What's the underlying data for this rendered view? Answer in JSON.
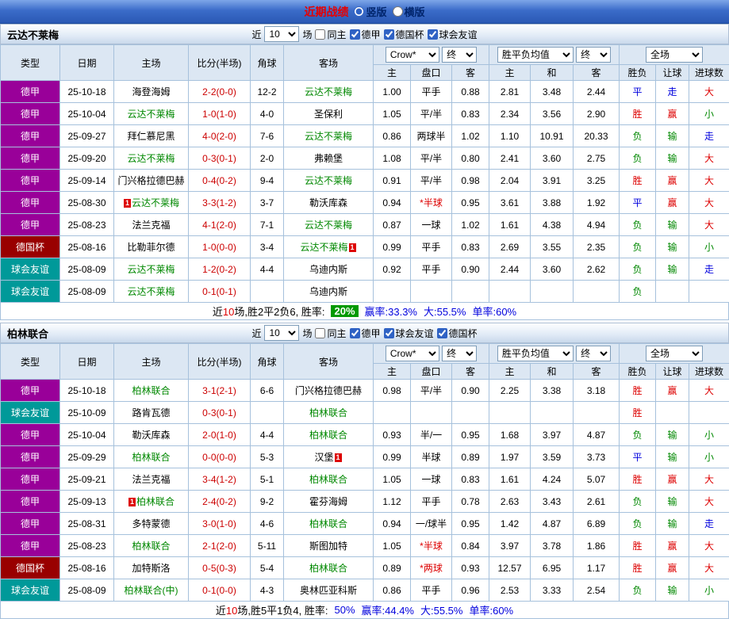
{
  "topbar": {
    "title": "近期战绩",
    "view_options": [
      {
        "label": "竖版",
        "selected": true
      },
      {
        "label": "横版",
        "selected": false
      }
    ]
  },
  "controls": {
    "recent_label": "近",
    "recent_value": "10",
    "games_label": "场",
    "same_home_label": "同主",
    "odds_company_select": "Crow*",
    "final_select": "终",
    "wdl_select": "胜平负均值",
    "scope_select": "全场"
  },
  "columns": {
    "type": "类型",
    "date": "日期",
    "home": "主场",
    "score": "比分(半场)",
    "corner": "角球",
    "away": "客场",
    "ah_home": "主",
    "ah_line": "盘口",
    "ah_away": "客",
    "eu_home": "主",
    "eu_draw": "和",
    "eu_away": "客",
    "wdl": "胜负",
    "handicap": "让球",
    "goals": "进球数"
  },
  "colors": {
    "league_dejia": "#990099",
    "league_deguobei": "#990000",
    "league_qiuhuiyouyi": "#009999",
    "result_win": "#dd0000",
    "result_draw": "#0000dd",
    "result_lose": "#008800",
    "focus_team": "#008800",
    "score_text": "#cc0000",
    "rate_badge_bg": "#009900"
  },
  "sections": [
    {
      "team": "云达不莱梅",
      "filter_leagues": [
        "德甲",
        "德国杯",
        "球会友谊"
      ],
      "rows": [
        {
          "type": "德甲",
          "date": "25-10-18",
          "home": {
            "t": "海登海姆"
          },
          "score": "2-2(0-0)",
          "corner": "12-2",
          "away": {
            "t": "云达不莱梅",
            "focus": true
          },
          "odds": [
            "1.00",
            "平手",
            "0.88",
            "2.81",
            "3.48",
            "2.44"
          ],
          "results": [
            [
              "平",
              "d"
            ],
            [
              "走",
              "d"
            ],
            [
              "大",
              "w"
            ]
          ]
        },
        {
          "type": "德甲",
          "date": "25-10-04",
          "home": {
            "t": "云达不莱梅",
            "focus": true
          },
          "score": "1-0(1-0)",
          "corner": "4-0",
          "away": {
            "t": "圣保利"
          },
          "odds": [
            "1.05",
            "平/半",
            "0.83",
            "2.34",
            "3.56",
            "2.90"
          ],
          "results": [
            [
              "胜",
              "w"
            ],
            [
              "赢",
              "w"
            ],
            [
              "小",
              "l"
            ]
          ]
        },
        {
          "type": "德甲",
          "date": "25-09-27",
          "home": {
            "t": "拜仁慕尼黑"
          },
          "score": "4-0(2-0)",
          "corner": "7-6",
          "away": {
            "t": "云达不莱梅",
            "focus": true
          },
          "odds": [
            "0.86",
            "两球半",
            "1.02",
            "1.10",
            "10.91",
            "20.33"
          ],
          "results": [
            [
              "负",
              "l"
            ],
            [
              "输",
              "l"
            ],
            [
              "走",
              "d"
            ]
          ]
        },
        {
          "type": "德甲",
          "date": "25-09-20",
          "home": {
            "t": "云达不莱梅",
            "focus": true
          },
          "score": "0-3(0-1)",
          "corner": "2-0",
          "away": {
            "t": "弗赖堡"
          },
          "odds": [
            "1.08",
            "平/半",
            "0.80",
            "2.41",
            "3.60",
            "2.75"
          ],
          "results": [
            [
              "负",
              "l"
            ],
            [
              "输",
              "l"
            ],
            [
              "大",
              "w"
            ]
          ]
        },
        {
          "type": "德甲",
          "date": "25-09-14",
          "home": {
            "t": "门兴格拉德巴赫"
          },
          "score": "0-4(0-2)",
          "corner": "9-4",
          "away": {
            "t": "云达不莱梅",
            "focus": true
          },
          "odds": [
            "0.91",
            "平/半",
            "0.98",
            "2.04",
            "3.91",
            "3.25"
          ],
          "results": [
            [
              "胜",
              "w"
            ],
            [
              "赢",
              "w"
            ],
            [
              "大",
              "w"
            ]
          ]
        },
        {
          "type": "德甲",
          "date": "25-08-30",
          "home": {
            "t": "云达不莱梅",
            "focus": true,
            "badge": "1",
            "badge_pos": "before"
          },
          "score": "3-3(1-2)",
          "corner": "3-7",
          "away": {
            "t": "勒沃库森"
          },
          "odds": [
            "0.94",
            "*半球",
            "0.95",
            "3.61",
            "3.88",
            "1.92"
          ],
          "results": [
            [
              "平",
              "d"
            ],
            [
              "赢",
              "w"
            ],
            [
              "大",
              "w"
            ]
          ]
        },
        {
          "type": "德甲",
          "date": "25-08-23",
          "home": {
            "t": "法兰克福"
          },
          "score": "4-1(2-0)",
          "corner": "7-1",
          "away": {
            "t": "云达不莱梅",
            "focus": true
          },
          "odds": [
            "0.87",
            "一球",
            "1.02",
            "1.61",
            "4.38",
            "4.94"
          ],
          "results": [
            [
              "负",
              "l"
            ],
            [
              "输",
              "l"
            ],
            [
              "大",
              "w"
            ]
          ]
        },
        {
          "type": "德国杯",
          "date": "25-08-16",
          "home": {
            "t": "比勒菲尔德"
          },
          "score": "1-0(0-0)",
          "corner": "3-4",
          "away": {
            "t": "云达不莱梅",
            "focus": true,
            "badge": "1",
            "badge_pos": "after"
          },
          "odds": [
            "0.99",
            "平手",
            "0.83",
            "2.69",
            "3.55",
            "2.35"
          ],
          "results": [
            [
              "负",
              "l"
            ],
            [
              "输",
              "l"
            ],
            [
              "小",
              "l"
            ]
          ]
        },
        {
          "type": "球会友谊",
          "date": "25-08-09",
          "home": {
            "t": "云达不莱梅",
            "focus": true
          },
          "score": "1-2(0-2)",
          "corner": "4-4",
          "away": {
            "t": "乌迪内斯"
          },
          "odds": [
            "0.92",
            "平手",
            "0.90",
            "2.44",
            "3.60",
            "2.62"
          ],
          "results": [
            [
              "负",
              "l"
            ],
            [
              "输",
              "l"
            ],
            [
              "走",
              "d"
            ]
          ]
        },
        {
          "type": "球会友谊",
          "date": "25-08-09",
          "home": {
            "t": "云达不莱梅",
            "focus": true
          },
          "score": "0-1(0-1)",
          "corner": "",
          "away": {
            "t": "乌迪内斯"
          },
          "odds": [
            "",
            "",
            "",
            "",
            "",
            ""
          ],
          "results": [
            [
              "负",
              "l"
            ],
            [
              "",
              ""
            ],
            [
              "",
              ""
            ]
          ]
        }
      ],
      "summary": {
        "prefix": "近",
        "count": "10",
        "mid": "场,胜2平2负6, 胜率:",
        "rate": "20%",
        "rate_style": "rate-badge",
        "win": "赢率:33.3%",
        "big": "大:55.5%",
        "single": "单率:60%"
      }
    },
    {
      "team": "柏林联合",
      "filter_leagues": [
        "德甲",
        "球会友谊",
        "德国杯"
      ],
      "rows": [
        {
          "type": "德甲",
          "date": "25-10-18",
          "home": {
            "t": "柏林联合",
            "focus": true
          },
          "score": "3-1(2-1)",
          "corner": "6-6",
          "away": {
            "t": "门兴格拉德巴赫"
          },
          "odds": [
            "0.98",
            "平/半",
            "0.90",
            "2.25",
            "3.38",
            "3.18"
          ],
          "results": [
            [
              "胜",
              "w"
            ],
            [
              "赢",
              "w"
            ],
            [
              "大",
              "w"
            ]
          ]
        },
        {
          "type": "球会友谊",
          "date": "25-10-09",
          "home": {
            "t": "路肯瓦德"
          },
          "score": "0-3(0-1)",
          "corner": "",
          "away": {
            "t": "柏林联合",
            "focus": true
          },
          "odds": [
            "",
            "",
            "",
            "",
            "",
            ""
          ],
          "results": [
            [
              "胜",
              "w"
            ],
            [
              "",
              ""
            ],
            [
              "",
              ""
            ]
          ]
        },
        {
          "type": "德甲",
          "date": "25-10-04",
          "home": {
            "t": "勒沃库森"
          },
          "score": "2-0(1-0)",
          "corner": "4-4",
          "away": {
            "t": "柏林联合",
            "focus": true
          },
          "odds": [
            "0.93",
            "半/一",
            "0.95",
            "1.68",
            "3.97",
            "4.87"
          ],
          "results": [
            [
              "负",
              "l"
            ],
            [
              "输",
              "l"
            ],
            [
              "小",
              "l"
            ]
          ]
        },
        {
          "type": "德甲",
          "date": "25-09-29",
          "home": {
            "t": "柏林联合",
            "focus": true
          },
          "score": "0-0(0-0)",
          "corner": "5-3",
          "away": {
            "t": "汉堡",
            "badge": "1",
            "badge_pos": "after"
          },
          "odds": [
            "0.99",
            "半球",
            "0.89",
            "1.97",
            "3.59",
            "3.73"
          ],
          "results": [
            [
              "平",
              "d"
            ],
            [
              "输",
              "l"
            ],
            [
              "小",
              "l"
            ]
          ]
        },
        {
          "type": "德甲",
          "date": "25-09-21",
          "home": {
            "t": "法兰克福"
          },
          "score": "3-4(1-2)",
          "corner": "5-1",
          "away": {
            "t": "柏林联合",
            "focus": true
          },
          "odds": [
            "1.05",
            "一球",
            "0.83",
            "1.61",
            "4.24",
            "5.07"
          ],
          "results": [
            [
              "胜",
              "w"
            ],
            [
              "赢",
              "w"
            ],
            [
              "大",
              "w"
            ]
          ]
        },
        {
          "type": "德甲",
          "date": "25-09-13",
          "home": {
            "t": "柏林联合",
            "focus": true,
            "badge": "1",
            "badge_pos": "before"
          },
          "score": "2-4(0-2)",
          "corner": "9-2",
          "away": {
            "t": "霍芬海姆"
          },
          "odds": [
            "1.12",
            "平手",
            "0.78",
            "2.63",
            "3.43",
            "2.61"
          ],
          "results": [
            [
              "负",
              "l"
            ],
            [
              "输",
              "l"
            ],
            [
              "大",
              "w"
            ]
          ]
        },
        {
          "type": "德甲",
          "date": "25-08-31",
          "home": {
            "t": "多特蒙德"
          },
          "score": "3-0(1-0)",
          "corner": "4-6",
          "away": {
            "t": "柏林联合",
            "focus": true
          },
          "odds": [
            "0.94",
            "一/球半",
            "0.95",
            "1.42",
            "4.87",
            "6.89"
          ],
          "results": [
            [
              "负",
              "l"
            ],
            [
              "输",
              "l"
            ],
            [
              "走",
              "d"
            ]
          ]
        },
        {
          "type": "德甲",
          "date": "25-08-23",
          "home": {
            "t": "柏林联合",
            "focus": true
          },
          "score": "2-1(2-0)",
          "corner": "5-11",
          "away": {
            "t": "斯图加特"
          },
          "odds": [
            "1.05",
            "*半球",
            "0.84",
            "3.97",
            "3.78",
            "1.86"
          ],
          "results": [
            [
              "胜",
              "w"
            ],
            [
              "赢",
              "w"
            ],
            [
              "大",
              "w"
            ]
          ]
        },
        {
          "type": "德国杯",
          "date": "25-08-16",
          "home": {
            "t": "加特斯洛"
          },
          "score": "0-5(0-3)",
          "corner": "5-4",
          "away": {
            "t": "柏林联合",
            "focus": true
          },
          "odds": [
            "0.89",
            "*两球",
            "0.93",
            "12.57",
            "6.95",
            "1.17"
          ],
          "results": [
            [
              "胜",
              "w"
            ],
            [
              "赢",
              "w"
            ],
            [
              "大",
              "w"
            ]
          ]
        },
        {
          "type": "球会友谊",
          "date": "25-08-09",
          "home": {
            "t": "柏林联合(中)",
            "focus": true
          },
          "score": "0-1(0-0)",
          "corner": "4-3",
          "away": {
            "t": "奥林匹亚科斯"
          },
          "odds": [
            "0.86",
            "平手",
            "0.96",
            "2.53",
            "3.33",
            "2.54"
          ],
          "results": [
            [
              "负",
              "l"
            ],
            [
              "输",
              "l"
            ],
            [
              "小",
              "l"
            ]
          ]
        }
      ],
      "summary": {
        "prefix": "近",
        "count": "10",
        "mid": "场,胜5平1负4, 胜率:",
        "rate": "50%",
        "rate_style": "rate-blue",
        "win": "赢率:44.4%",
        "big": "大:55.5%",
        "single": "单率:60%"
      }
    }
  ]
}
